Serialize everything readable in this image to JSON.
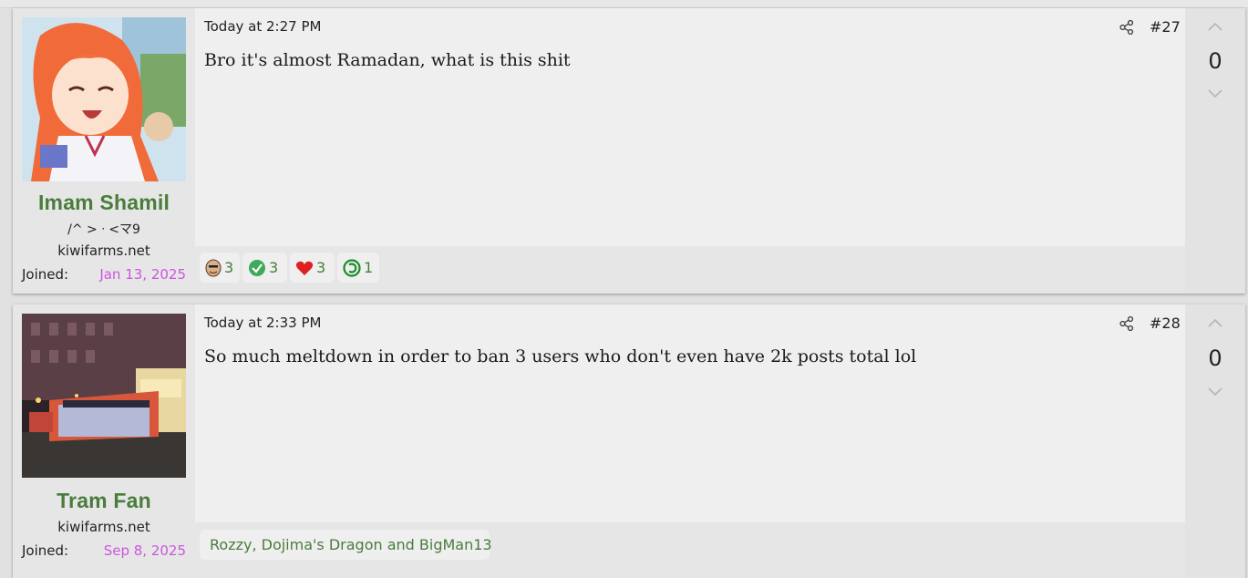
{
  "posts": [
    {
      "username": "Imam Shamil",
      "user_title": "/^ > ᐧ <マ9",
      "user_site": "kiwifarms.net",
      "joined_label": "Joined:",
      "joined_date": "Jan 13, 2025",
      "time": "Today at 2:27 PM",
      "post_number": "#27",
      "text": "Bro it's almost Ramadan, what is this shit",
      "score": "0",
      "reactions": [
        {
          "icon": "face-icon",
          "count": "3"
        },
        {
          "icon": "checkmark-icon",
          "count": "3"
        },
        {
          "icon": "heart-icon",
          "count": "3"
        },
        {
          "icon": "copyleft-icon",
          "count": "1"
        }
      ]
    },
    {
      "username": "Tram Fan",
      "user_site": "kiwifarms.net",
      "joined_label": "Joined:",
      "joined_date": "Sep 8, 2025",
      "time": "Today at 2:33 PM",
      "post_number": "#28",
      "text": "So much meltdown in order to ban 3 users who don't even have 2k posts total lol",
      "score": "0",
      "reaction_summary": {
        "icon": "face-icon",
        "names": "Rozzy, Dojima's Dragon and BigMan13"
      }
    }
  ],
  "colors": {
    "username": "#4a7c3c",
    "joined_date": "#cc55e0",
    "reaction_text": "#4a7c3c"
  }
}
